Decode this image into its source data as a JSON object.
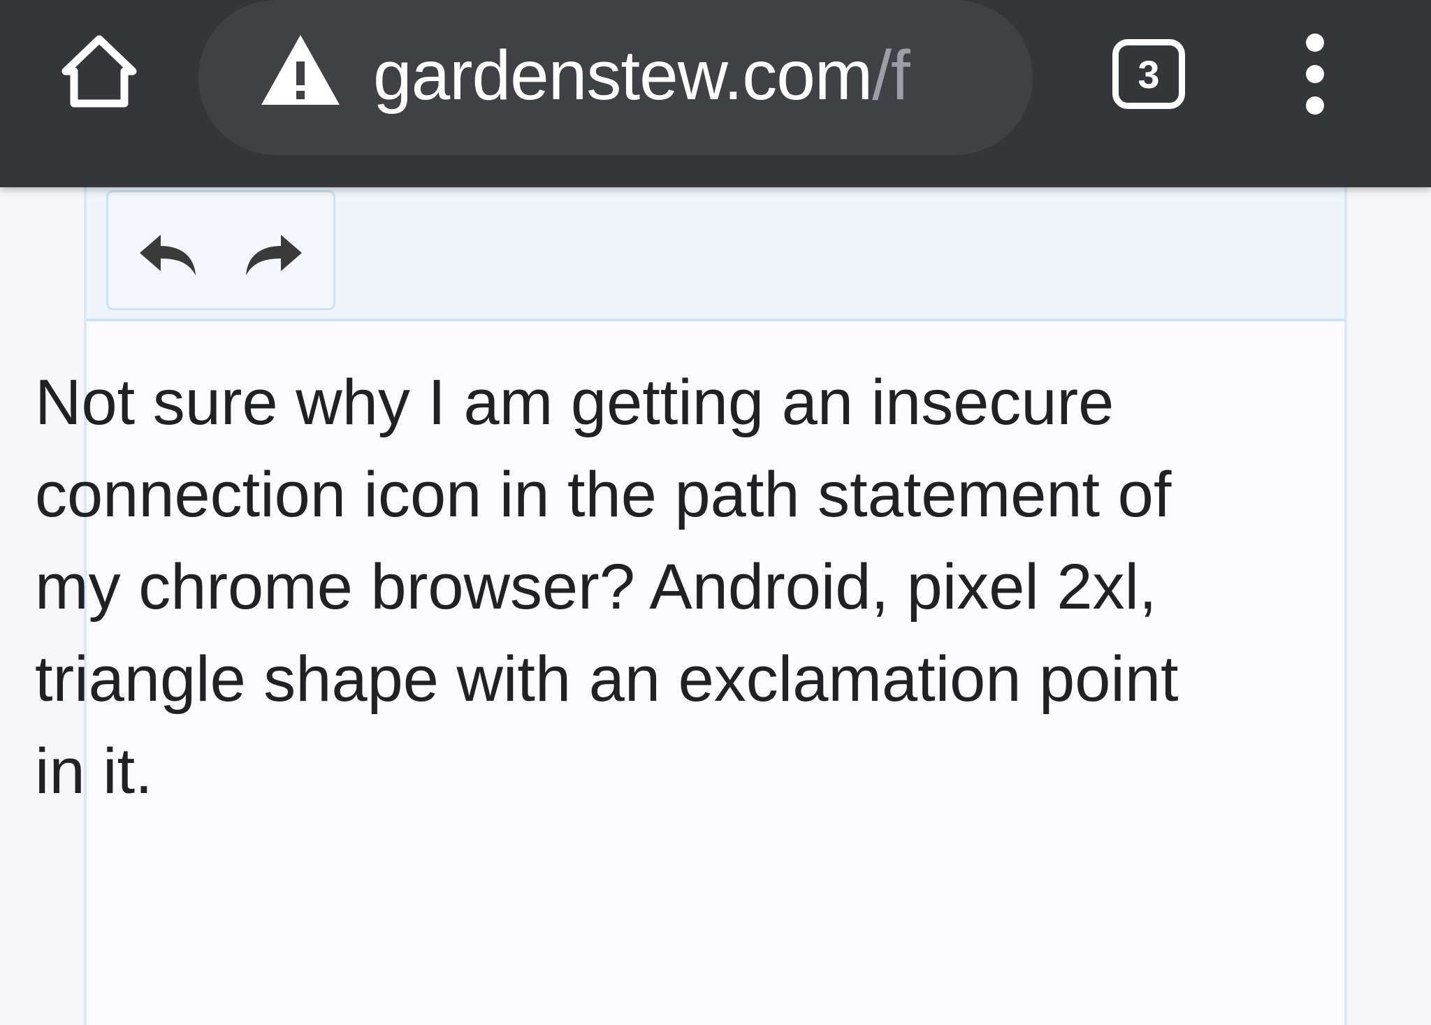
{
  "browser": {
    "home_icon": "home-icon",
    "security_icon": "warning-triangle-icon",
    "url_host": "gardenstew.com",
    "url_path": "/f",
    "tab_count": "3",
    "menu_icon": "more-vert-icon",
    "toolbar_color": "#35363a"
  },
  "editor": {
    "undo_icon": "undo-icon",
    "redo_icon": "redo-icon",
    "content": "Not sure why I am getting an insecure connection icon in the path statement of my chrome browser? Android, pixel 2xl, triangle shape with an exclamation point in it."
  }
}
